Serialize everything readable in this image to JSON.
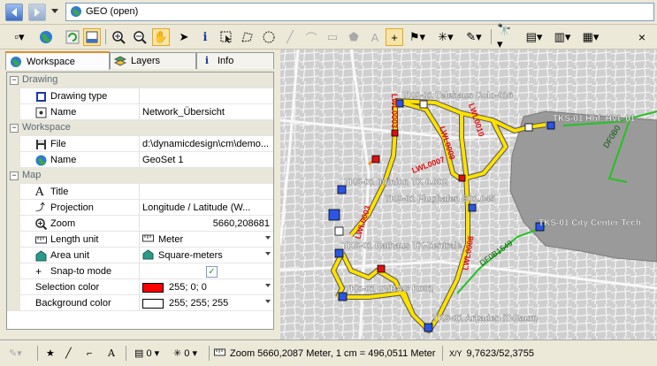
{
  "address": {
    "title": "GEO  (open)"
  },
  "toolbar": {
    "close_label": "×"
  },
  "tabs": [
    {
      "label": "Workspace"
    },
    {
      "label": "Layers"
    },
    {
      "label": "Info"
    }
  ],
  "properties": {
    "categories": {
      "drawing": "Drawing",
      "workspace": "Workspace",
      "map": "Map"
    },
    "drawing_type": {
      "name": "Drawing type",
      "value": ""
    },
    "drawing_name": {
      "name": "Name",
      "value": "Network_Übersicht"
    },
    "file": {
      "name": "File",
      "value": "d:\\dynamicdesign\\cm\\demo..."
    },
    "workspace_name": {
      "name": "Name",
      "value": "GeoSet 1"
    },
    "title": {
      "name": "Title",
      "value": ""
    },
    "projection": {
      "name": "Projection",
      "value": "Longitude / Latitude (W..."
    },
    "zoom": {
      "name": "Zoom",
      "value": "5660,208681"
    },
    "length_unit": {
      "name": "Length unit",
      "value": "Meter"
    },
    "area_unit": {
      "name": "Area unit",
      "value": "Square-meters"
    },
    "snap_to_mode": {
      "name": "Snap-to mode",
      "checked": true
    },
    "selection_color": {
      "name": "Selection color",
      "value": "255; 0; 0",
      "swatch": "#ff0000"
    },
    "background_color": {
      "name": "Background color",
      "value": "255; 255; 255",
      "swatch": "#ffffff"
    }
  },
  "map": {
    "labels": [
      {
        "text": "TKS-01 Telehaus Colo-016"
      },
      {
        "text": "TKS-01 Hbf. HVt_01"
      },
      {
        "text": "TKS-01 Infinion TK 0.002"
      },
      {
        "text": "TKS-01 Flughafen S01.045"
      },
      {
        "text": "TKS-01 City Center Tech"
      },
      {
        "text": "TKS-01 Rathaus TK-Zentrale"
      },
      {
        "text": "TKS-01 DVBAG K001"
      },
      {
        "text": "TKS-01 Arkaden IT-Raum"
      }
    ],
    "cable_labels": [
      {
        "text": "LWL0003"
      },
      {
        "text": "LWL0010"
      },
      {
        "text": "LWL0009"
      },
      {
        "text": "LWL0007"
      },
      {
        "text": "LWL0008"
      },
      {
        "text": "LWL0003"
      },
      {
        "text": "DF0B1549"
      },
      {
        "text": "DF0B0"
      }
    ]
  },
  "status": {
    "layer_count_1": "0",
    "layer_count_2": "0",
    "zoom_text": "Zoom 5660,2087 Meter, 1 cm = 496,0511 Meter",
    "xy_label": "X/Y",
    "xy_value": "9,7623/52,3755"
  }
}
